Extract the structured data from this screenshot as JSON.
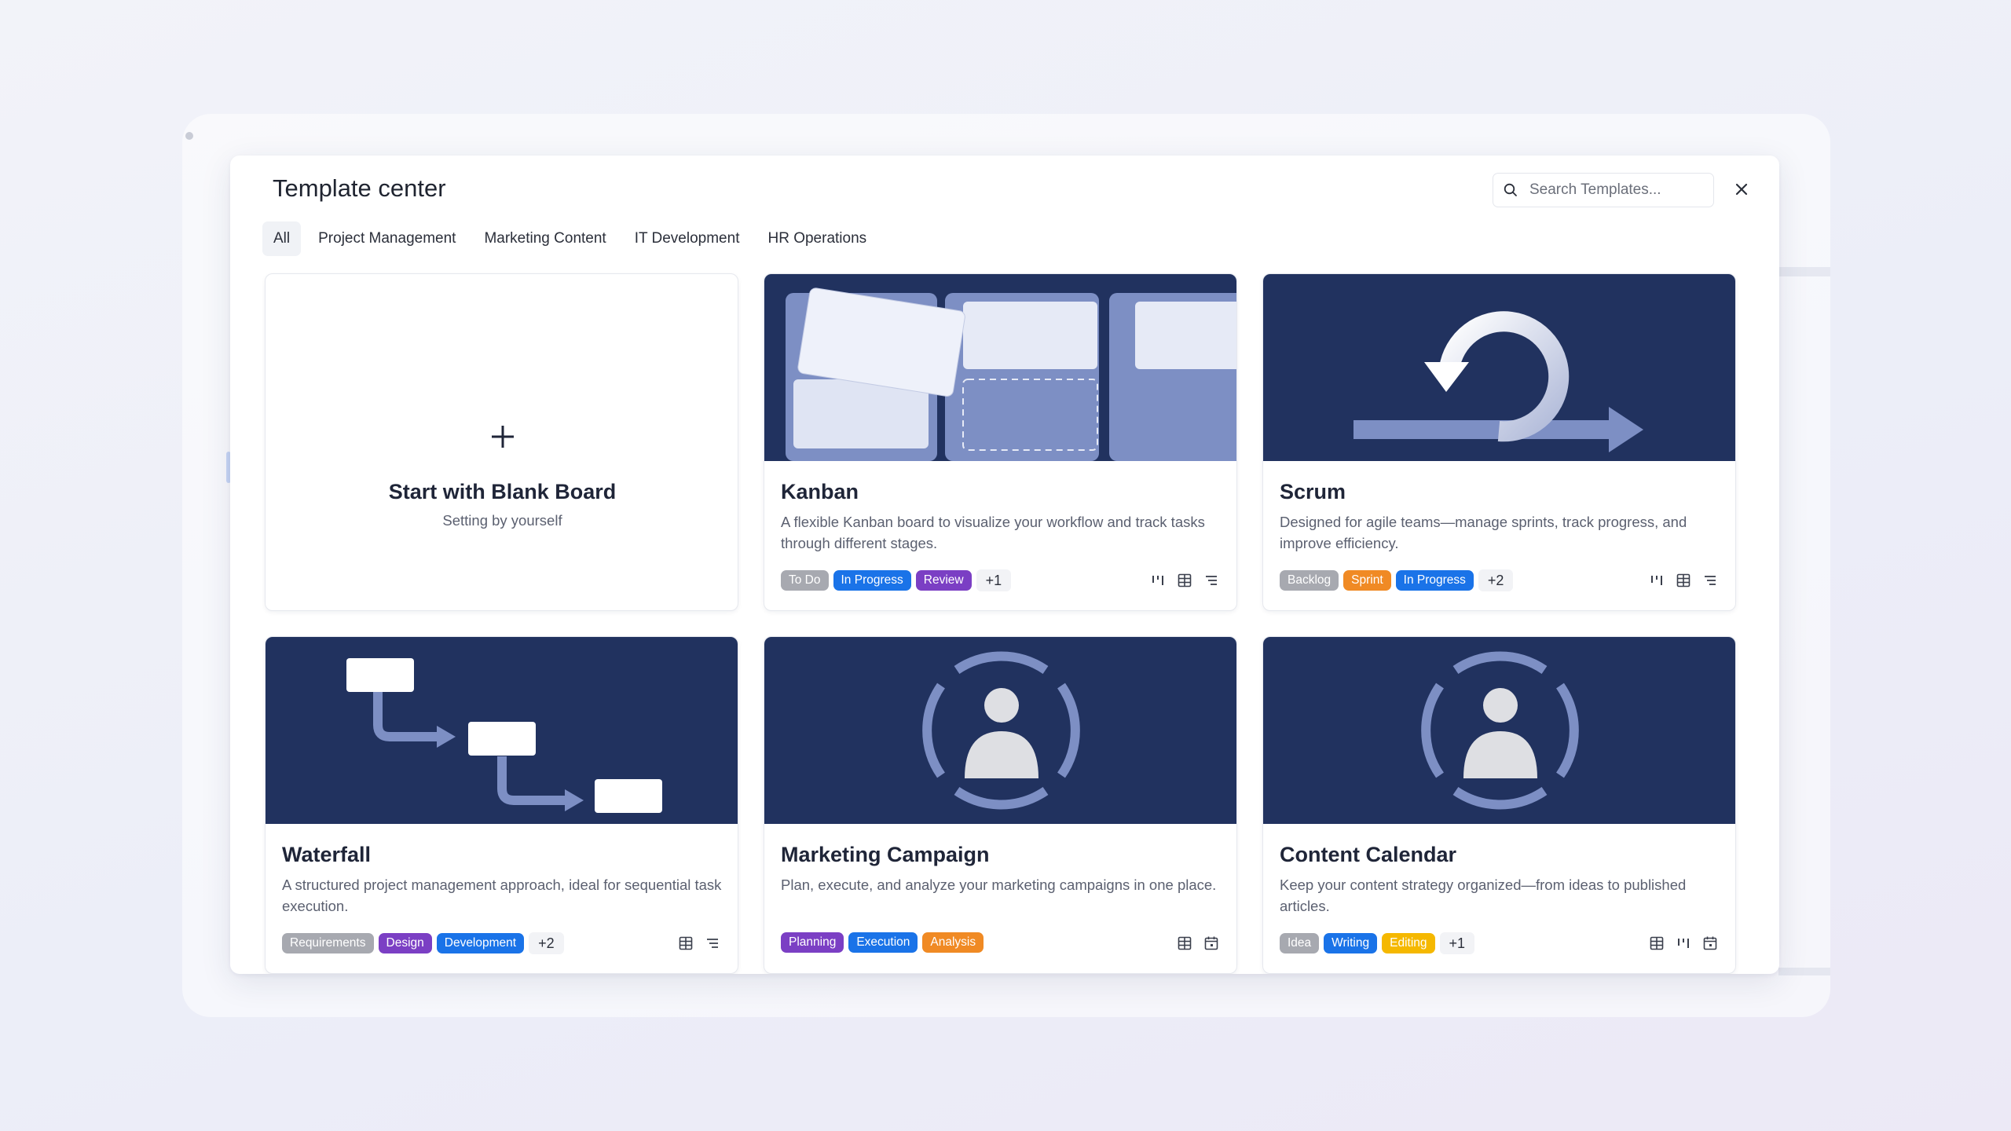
{
  "modal": {
    "title": "Template center",
    "search_placeholder": "Search Templates...",
    "close_label": "×"
  },
  "tabs": [
    {
      "label": "All",
      "active": true
    },
    {
      "label": "Project Management",
      "active": false
    },
    {
      "label": "Marketing Content",
      "active": false
    },
    {
      "label": "IT Development",
      "active": false
    },
    {
      "label": "HR Operations",
      "active": false
    }
  ],
  "blank": {
    "plus": "+",
    "title": "Start with Blank Board",
    "subtitle": "Setting by yourself"
  },
  "cards": [
    {
      "title": "Kanban",
      "description": "A flexible Kanban board to visualize your workflow and track tasks through different stages.",
      "tags": [
        {
          "label": "To Do",
          "color": "#a7a9b0"
        },
        {
          "label": "In Progress",
          "color": "#1a73e8"
        },
        {
          "label": "Review",
          "color": "#7b3fc4"
        }
      ],
      "more": "+1",
      "views": [
        "kanban-icon",
        "table-icon",
        "list-icon"
      ]
    },
    {
      "title": "Scrum",
      "description": "Designed for agile teams—manage sprints, track progress, and improve efficiency.",
      "tags": [
        {
          "label": "Backlog",
          "color": "#a7a9b0"
        },
        {
          "label": "Sprint",
          "color": "#f08a24"
        },
        {
          "label": "In Progress",
          "color": "#1a73e8"
        }
      ],
      "more": "+2",
      "views": [
        "kanban-icon",
        "table-icon",
        "list-icon"
      ]
    },
    {
      "title": "Waterfall",
      "description": "A structured project management approach, ideal for sequential task execution.",
      "tags": [
        {
          "label": "Requirements",
          "color": "#a7a9b0"
        },
        {
          "label": "Design",
          "color": "#7b3fc4"
        },
        {
          "label": "Development",
          "color": "#1a73e8"
        }
      ],
      "more": "+2",
      "views": [
        "table-icon",
        "list-icon"
      ]
    },
    {
      "title": "Marketing Campaign",
      "description": "Plan, execute, and analyze your marketing campaigns in one place.",
      "tags": [
        {
          "label": "Planning",
          "color": "#7b3fc4"
        },
        {
          "label": "Execution",
          "color": "#1a73e8"
        },
        {
          "label": "Analysis",
          "color": "#f08a24"
        }
      ],
      "more": "",
      "views": [
        "table-icon",
        "calendar-icon"
      ]
    },
    {
      "title": "Content Calendar",
      "description": "Keep your content strategy organized—from ideas to published articles.",
      "tags": [
        {
          "label": "Idea",
          "color": "#a7a9b0"
        },
        {
          "label": "Writing",
          "color": "#1a73e8"
        },
        {
          "label": "Editing",
          "color": "#f5b800"
        }
      ],
      "more": "+1",
      "views": [
        "table-icon",
        "kanban-icon",
        "calendar-icon"
      ]
    }
  ],
  "colors": {
    "thumb_bg": "#21325f",
    "accent_light": "#7d8fc4"
  }
}
